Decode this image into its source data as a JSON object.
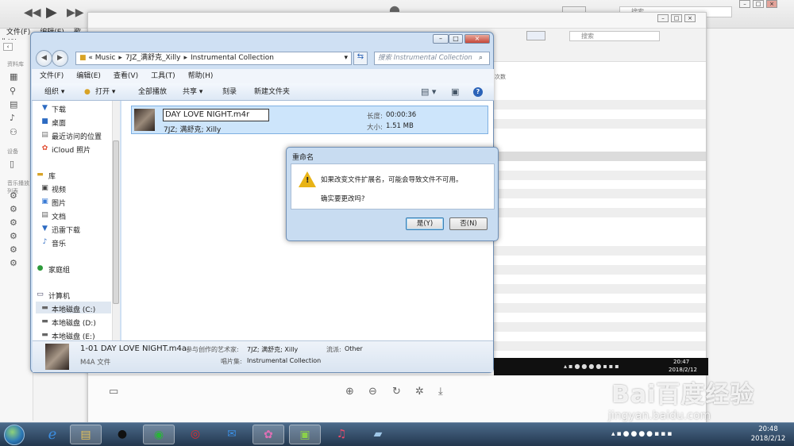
{
  "itunes": {
    "menu": [
      "文件(F)",
      "编辑(E)",
      "歌曲(S)"
    ],
    "side_sections": [
      "资料库",
      "设备",
      "音乐播放列表"
    ],
    "top_search_placeholder": "搜索",
    "mid_search_placeholder": "搜索",
    "col_partial": "次数",
    "tray_mini_time": "20:47",
    "tray_mini_date": "2018/2/12"
  },
  "explorer": {
    "address": {
      "prefix": "«",
      "parts": [
        "Music",
        "7JZ_满舒克_Xilly",
        "Instrumental Collection"
      ]
    },
    "search_placeholder": "搜索 Instrumental Collection",
    "menu": [
      "文件(F)",
      "编辑(E)",
      "查看(V)",
      "工具(T)",
      "帮助(H)"
    ],
    "toolbar": {
      "organize": "组织 ▾",
      "open": "打开 ▾",
      "play_all": "全部播放",
      "share": "共享 ▾",
      "burn": "刻录",
      "new_folder": "新建文件夹"
    },
    "nav": {
      "fav_items": [
        "下载",
        "桌面",
        "最近访问的位置",
        "iCloud 照片"
      ],
      "library_label": "库",
      "library_items": [
        "视频",
        "图片",
        "文档",
        "迅雷下载",
        "音乐"
      ],
      "homegroup": "家庭组",
      "computer": "计算机",
      "drives": [
        "本地磁盘 (C:)",
        "本地磁盘 (D:)",
        "本地磁盘 (E:)"
      ]
    },
    "file": {
      "rename_value": "DAY LOVE NIGHT.m4r",
      "artist": "7JZ; 满舒克; Xilly",
      "length_label": "长度:",
      "length_value": "00:00:36",
      "size_label": "大小:",
      "size_value": "1.51 MB"
    },
    "details": {
      "name": "1-01 DAY LOVE NIGHT.m4a",
      "contrib_label": "参与创作的艺术家:",
      "contrib_value": "7JZ; 满舒克; Xilly",
      "genre_label": "流派:",
      "genre_value": "Other",
      "type": "M4A 文件",
      "album_label": "唱片集:",
      "album_value": "Instrumental Collection"
    }
  },
  "dialog": {
    "title": "重命名",
    "message1": "如果改变文件扩展名，可能会导致文件不可用。",
    "message2": "确实要更改吗?",
    "yes": "是(Y)",
    "no": "否(N)"
  },
  "taskbar": {
    "time": "20:48",
    "date": "2018/2/12"
  },
  "watermark": {
    "main": "Bai百度经验",
    "sub": "jingyan.baidu.com"
  }
}
